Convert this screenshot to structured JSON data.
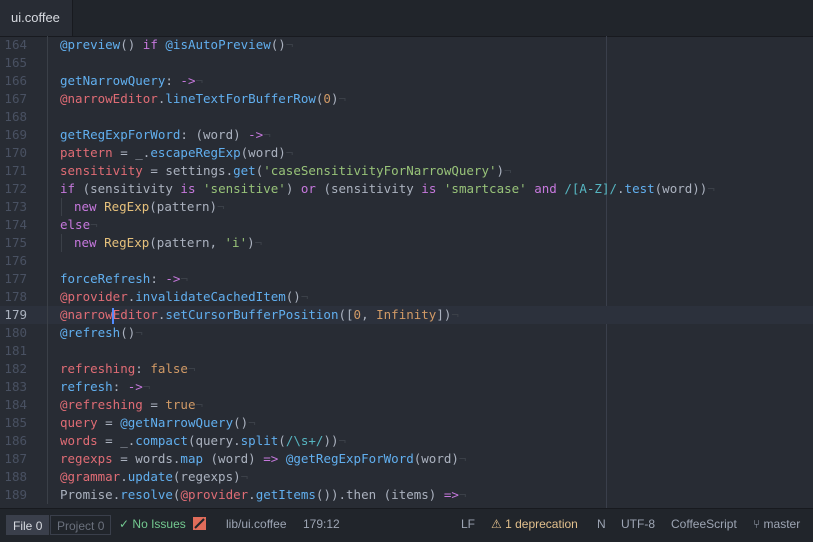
{
  "tab": {
    "title": "ui.coffee"
  },
  "editor": {
    "cursor_line": 179,
    "lines": [
      {
        "num": "164",
        "indent": 1,
        "tokens": [
          [
            "@preview",
            "fn"
          ],
          [
            "() ",
            "pl"
          ],
          [
            "if",
            "kw"
          ],
          [
            " ",
            "pl"
          ],
          [
            "@isAutoPreview",
            "fn"
          ],
          [
            "()",
            "pl"
          ]
        ]
      },
      {
        "num": "165",
        "indent": 0,
        "tokens": []
      },
      {
        "num": "166",
        "indent": 0,
        "tokens": [
          [
            "getNarrowQuery",
            "fn"
          ],
          [
            ": ",
            "pl"
          ],
          [
            "->",
            "kw"
          ]
        ]
      },
      {
        "num": "167",
        "indent": 1,
        "tokens": [
          [
            "@narrowEditor",
            "var"
          ],
          [
            ".",
            "pl"
          ],
          [
            "lineTextForBufferRow",
            "fn"
          ],
          [
            "(",
            "pl"
          ],
          [
            "0",
            "num"
          ],
          [
            ")",
            "pl"
          ]
        ]
      },
      {
        "num": "168",
        "indent": 0,
        "tokens": []
      },
      {
        "num": "169",
        "indent": 0,
        "tokens": [
          [
            "getRegExpForWord",
            "fn"
          ],
          [
            ": (word) ",
            "pl"
          ],
          [
            "->",
            "kw"
          ]
        ]
      },
      {
        "num": "170",
        "indent": 1,
        "tokens": [
          [
            "pattern",
            "var"
          ],
          [
            " = ",
            "pl"
          ],
          [
            "_",
            "pl"
          ],
          [
            ".",
            "pl"
          ],
          [
            "escapeRegExp",
            "fn"
          ],
          [
            "(word)",
            "pl"
          ]
        ]
      },
      {
        "num": "171",
        "indent": 1,
        "tokens": [
          [
            "sensitivity",
            "var"
          ],
          [
            " = settings.",
            "pl"
          ],
          [
            "get",
            "fn"
          ],
          [
            "(",
            "pl"
          ],
          [
            "'caseSensitivityForNarrowQuery'",
            "str"
          ],
          [
            ")",
            "pl"
          ]
        ]
      },
      {
        "num": "172",
        "indent": 1,
        "tokens": [
          [
            "if",
            "kw"
          ],
          [
            " (sensitivity ",
            "pl"
          ],
          [
            "is",
            "kw"
          ],
          [
            " ",
            "pl"
          ],
          [
            "'sensitive'",
            "str"
          ],
          [
            ") ",
            "pl"
          ],
          [
            "or",
            "kw"
          ],
          [
            " (sensitivity ",
            "pl"
          ],
          [
            "is",
            "kw"
          ],
          [
            " ",
            "pl"
          ],
          [
            "'smartcase'",
            "str"
          ],
          [
            " ",
            "pl"
          ],
          [
            "and",
            "kw"
          ],
          [
            " ",
            "pl"
          ],
          [
            "/[A-Z]/",
            "op"
          ],
          [
            ".",
            "pl"
          ],
          [
            "test",
            "fn"
          ],
          [
            "(word))",
            "pl"
          ]
        ]
      },
      {
        "num": "173",
        "indent": 2,
        "tokens": [
          [
            "new",
            "kw"
          ],
          [
            " ",
            "pl"
          ],
          [
            "RegExp",
            "cls"
          ],
          [
            "(pattern)",
            "pl"
          ]
        ]
      },
      {
        "num": "174",
        "indent": 1,
        "tokens": [
          [
            "else",
            "kw"
          ]
        ]
      },
      {
        "num": "175",
        "indent": 2,
        "tokens": [
          [
            "new",
            "kw"
          ],
          [
            " ",
            "pl"
          ],
          [
            "RegExp",
            "cls"
          ],
          [
            "(pattern, ",
            "pl"
          ],
          [
            "'i'",
            "str"
          ],
          [
            ")",
            "pl"
          ]
        ]
      },
      {
        "num": "176",
        "indent": 0,
        "tokens": []
      },
      {
        "num": "177",
        "indent": 0,
        "tokens": [
          [
            "forceRefresh",
            "fn"
          ],
          [
            ": ",
            "pl"
          ],
          [
            "->",
            "kw"
          ]
        ]
      },
      {
        "num": "178",
        "indent": 1,
        "tokens": [
          [
            "@provider",
            "var"
          ],
          [
            ".",
            "pl"
          ],
          [
            "invalidateCachedItem",
            "fn"
          ],
          [
            "()",
            "pl"
          ]
        ]
      },
      {
        "num": "179",
        "indent": 1,
        "tokens": [
          [
            "@narrow",
            "var"
          ],
          [
            "|",
            "caret"
          ],
          [
            "Editor",
            "var"
          ],
          [
            ".",
            "pl"
          ],
          [
            "setCursorBufferPosition",
            "fn"
          ],
          [
            "([",
            "pl"
          ],
          [
            "0",
            "num"
          ],
          [
            ", ",
            "pl"
          ],
          [
            "Infinity",
            "num"
          ],
          [
            "])",
            "pl"
          ]
        ]
      },
      {
        "num": "180",
        "indent": 1,
        "tokens": [
          [
            "@refresh",
            "fn"
          ],
          [
            "()",
            "pl"
          ]
        ]
      },
      {
        "num": "181",
        "indent": 0,
        "tokens": []
      },
      {
        "num": "182",
        "indent": 0,
        "tokens": [
          [
            "refreshing",
            "var"
          ],
          [
            ": ",
            "pl"
          ],
          [
            "false",
            "num"
          ]
        ]
      },
      {
        "num": "183",
        "indent": 0,
        "tokens": [
          [
            "refresh",
            "fn"
          ],
          [
            ": ",
            "pl"
          ],
          [
            "->",
            "kw"
          ]
        ]
      },
      {
        "num": "184",
        "indent": 1,
        "tokens": [
          [
            "@refreshing",
            "var"
          ],
          [
            " = ",
            "pl"
          ],
          [
            "true",
            "num"
          ]
        ]
      },
      {
        "num": "185",
        "indent": 1,
        "tokens": [
          [
            "query",
            "var"
          ],
          [
            " = ",
            "pl"
          ],
          [
            "@getNarrowQuery",
            "fn"
          ],
          [
            "()",
            "pl"
          ]
        ]
      },
      {
        "num": "186",
        "indent": 1,
        "tokens": [
          [
            "words",
            "var"
          ],
          [
            " = _.",
            "pl"
          ],
          [
            "compact",
            "fn"
          ],
          [
            "(query.",
            "pl"
          ],
          [
            "split",
            "fn"
          ],
          [
            "(",
            "pl"
          ],
          [
            "/\\s+/",
            "op"
          ],
          [
            "))",
            "pl"
          ]
        ]
      },
      {
        "num": "187",
        "indent": 1,
        "tokens": [
          [
            "regexps",
            "var"
          ],
          [
            " = words.",
            "pl"
          ],
          [
            "map",
            "fn"
          ],
          [
            " (word) ",
            "pl"
          ],
          [
            "=>",
            "kw"
          ],
          [
            " ",
            "pl"
          ],
          [
            "@getRegExpForWord",
            "fn"
          ],
          [
            "(word)",
            "pl"
          ]
        ]
      },
      {
        "num": "188",
        "indent": 1,
        "tokens": [
          [
            "@grammar",
            "var"
          ],
          [
            ".",
            "pl"
          ],
          [
            "update",
            "fn"
          ],
          [
            "(regexps)",
            "pl"
          ]
        ]
      },
      {
        "num": "189",
        "indent": 1,
        "tokens": [
          [
            "Promise",
            "pl"
          ],
          [
            ".",
            "pl"
          ],
          [
            "resolve",
            "fn"
          ],
          [
            "(",
            "pl"
          ],
          [
            "@provider",
            "var"
          ],
          [
            ".",
            "pl"
          ],
          [
            "getItems",
            "fn"
          ],
          [
            "()).then (items) ",
            "pl"
          ],
          [
            "=>",
            "kw"
          ]
        ]
      }
    ]
  },
  "status": {
    "file_label": "File",
    "file_count": "0",
    "project_label": "Project",
    "project_count": "0",
    "no_issues": "No Issues",
    "path": "lib/ui.coffee",
    "position": "179:12",
    "line_ending": "LF",
    "deprecation": "1 deprecation",
    "n_indicator": "N",
    "encoding": "UTF-8",
    "grammar": "CoffeeScript",
    "branch": "master"
  },
  "colors": {
    "background": "#282c34",
    "function": "#61afef",
    "variable": "#e06c75",
    "keyword": "#c678dd",
    "string": "#98c379",
    "number": "#d19a66",
    "class": "#e5c07b",
    "ok": "#73c990",
    "warning": "#e2c08d"
  }
}
